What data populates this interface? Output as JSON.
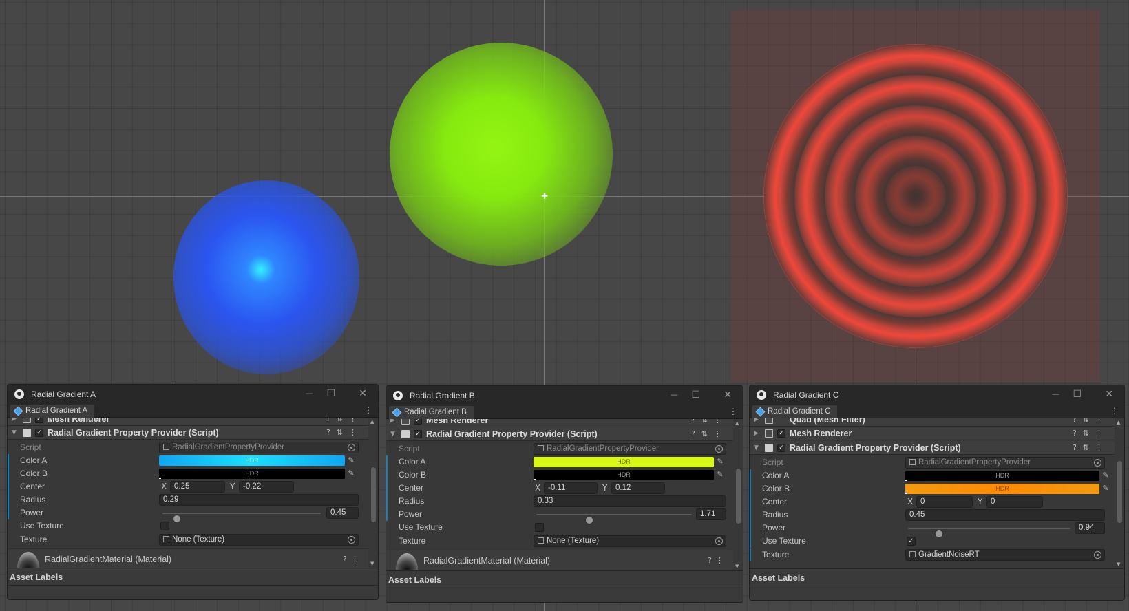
{
  "colors": {
    "accent_override": "#0f81be",
    "window_bg": "#383838",
    "titlebar_bg": "#282828"
  },
  "windows": [
    {
      "title": "Radial Gradient A",
      "tab": "Radial Gradient A",
      "components": [
        "Mesh Renderer",
        "Radial Gradient Property Provider (Script)"
      ],
      "props": {
        "script_label": "Script",
        "script_value": "RadialGradientPropertyProvider",
        "color_a_label": "Color A",
        "color_a_value": "#19c0ff",
        "color_b_label": "Color B",
        "color_b_value": "#000000",
        "hdr_label": "HDR",
        "center_label": "Center",
        "center_x_label": "X",
        "center_x": "0.25",
        "center_y_label": "Y",
        "center_y": "-0.22",
        "radius_label": "Radius",
        "radius": "0.29",
        "power_label": "Power",
        "power": "0.45",
        "power_fraction": 0.09,
        "use_texture_label": "Use Texture",
        "use_texture": false,
        "texture_label": "Texture",
        "texture_value": "None (Texture)"
      },
      "material": "RadialGradientMaterial (Material)",
      "footer": "Asset Labels"
    },
    {
      "title": "Radial Gradient B",
      "tab": "Radial Gradient B",
      "components": [
        "Mesh Renderer",
        "Radial Gradient Property Provider (Script)"
      ],
      "props": {
        "script_label": "Script",
        "script_value": "RadialGradientPropertyProvider",
        "color_a_label": "Color A",
        "color_a_value": "#d9f714",
        "color_b_label": "Color B",
        "color_b_value": "#000000",
        "hdr_label": "HDR",
        "center_label": "Center",
        "center_x_label": "X",
        "center_x": "-0.11",
        "center_y_label": "Y",
        "center_y": "0.12",
        "radius_label": "Radius",
        "radius": "0.33",
        "power_label": "Power",
        "power": "1.71",
        "power_fraction": 0.34,
        "use_texture_label": "Use Texture",
        "use_texture": false,
        "texture_label": "Texture",
        "texture_value": "None (Texture)"
      },
      "material": "RadialGradientMaterial (Material)",
      "footer": "Asset Labels"
    },
    {
      "title": "Radial Gradient C",
      "tab": "Radial Gradient C",
      "components": [
        "Quad (Mesh Filter)",
        "Mesh Renderer",
        "Radial Gradient Property Provider (Script)"
      ],
      "props": {
        "script_label": "Script",
        "script_value": "RadialGradientPropertyProvider",
        "color_a_label": "Color A",
        "color_a_value": "#000000",
        "color_b_label": "Color B",
        "color_b_value": "#f39a12",
        "hdr_label": "HDR",
        "center_label": "Center",
        "center_x_label": "X",
        "center_x": "0",
        "center_y_label": "Y",
        "center_y": "0",
        "radius_label": "Radius",
        "radius": "0.45",
        "power_label": "Power",
        "power": "0.94",
        "power_fraction": 0.19,
        "use_texture_label": "Use Texture",
        "use_texture": true,
        "texture_label": "Texture",
        "texture_value": "GradientNoiseRT"
      },
      "footer": "Asset Labels"
    }
  ]
}
